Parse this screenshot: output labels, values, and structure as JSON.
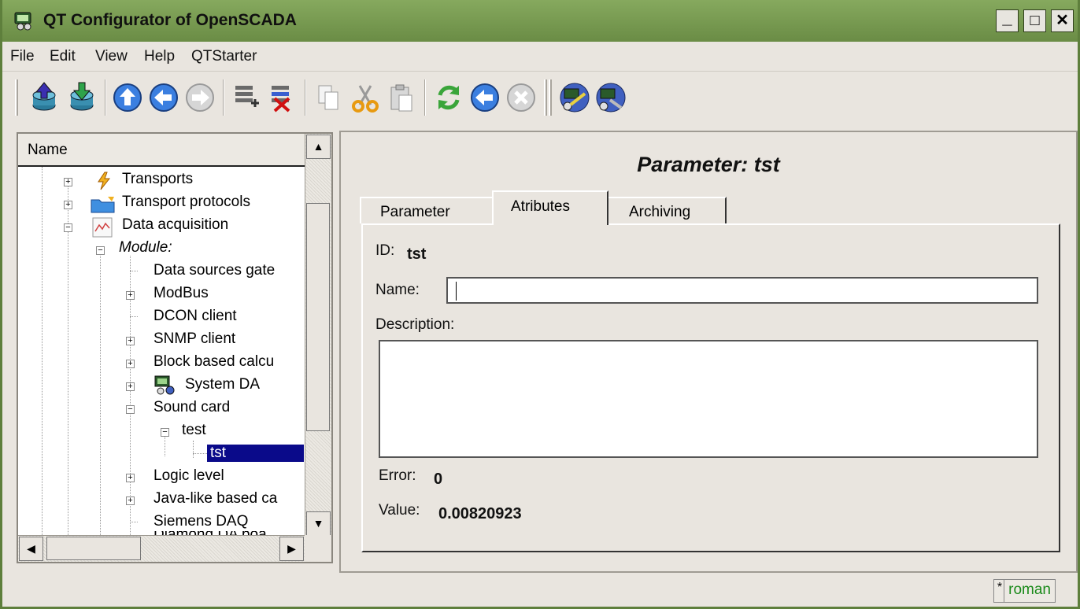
{
  "window": {
    "title": "QT Configurator of OpenSCADA",
    "minimize": "_",
    "maximize": "□",
    "close": "✕"
  },
  "menu": [
    "File",
    "Edit",
    "View",
    "Help",
    "QTStarter"
  ],
  "toolbar": {
    "icons": [
      "db-load-icon",
      "db-save-icon",
      "up-icon",
      "back-icon",
      "forward-icon",
      "add-item-icon",
      "delete-item-icon",
      "copy-icon",
      "cut-icon",
      "paste-icon",
      "refresh-icon",
      "start-icon",
      "stop-icon",
      "module-ui-icon",
      "module-system-icon"
    ]
  },
  "tree": {
    "header": "Name",
    "items": [
      {
        "label": "Transports"
      },
      {
        "label": "Transport protocols"
      },
      {
        "label": "Data acquisition"
      },
      {
        "label": "Module:"
      },
      {
        "label": "Data sources gate"
      },
      {
        "label": "ModBus"
      },
      {
        "label": "DCON client"
      },
      {
        "label": "SNMP client"
      },
      {
        "label": "Block based calcu"
      },
      {
        "label": "System DA"
      },
      {
        "label": "Sound card"
      },
      {
        "label": "test"
      },
      {
        "label": "tst"
      },
      {
        "label": "Logic level"
      },
      {
        "label": "Java-like based ca"
      },
      {
        "label": "Siemens DAQ"
      },
      {
        "label": "Diamond DA boa"
      }
    ]
  },
  "panel": {
    "heading": "Parameter: tst",
    "tabs": [
      "Parameter",
      "Atributes",
      "Archiving"
    ],
    "id_label": "ID:",
    "id_value": "tst",
    "name_label": "Name:",
    "name_value": "",
    "description_label": "Description:",
    "error_label": "Error:",
    "error_value": "0",
    "value_label": "Value:",
    "value_value": "0.00820923"
  },
  "status": {
    "modified": "*",
    "user": "roman"
  }
}
